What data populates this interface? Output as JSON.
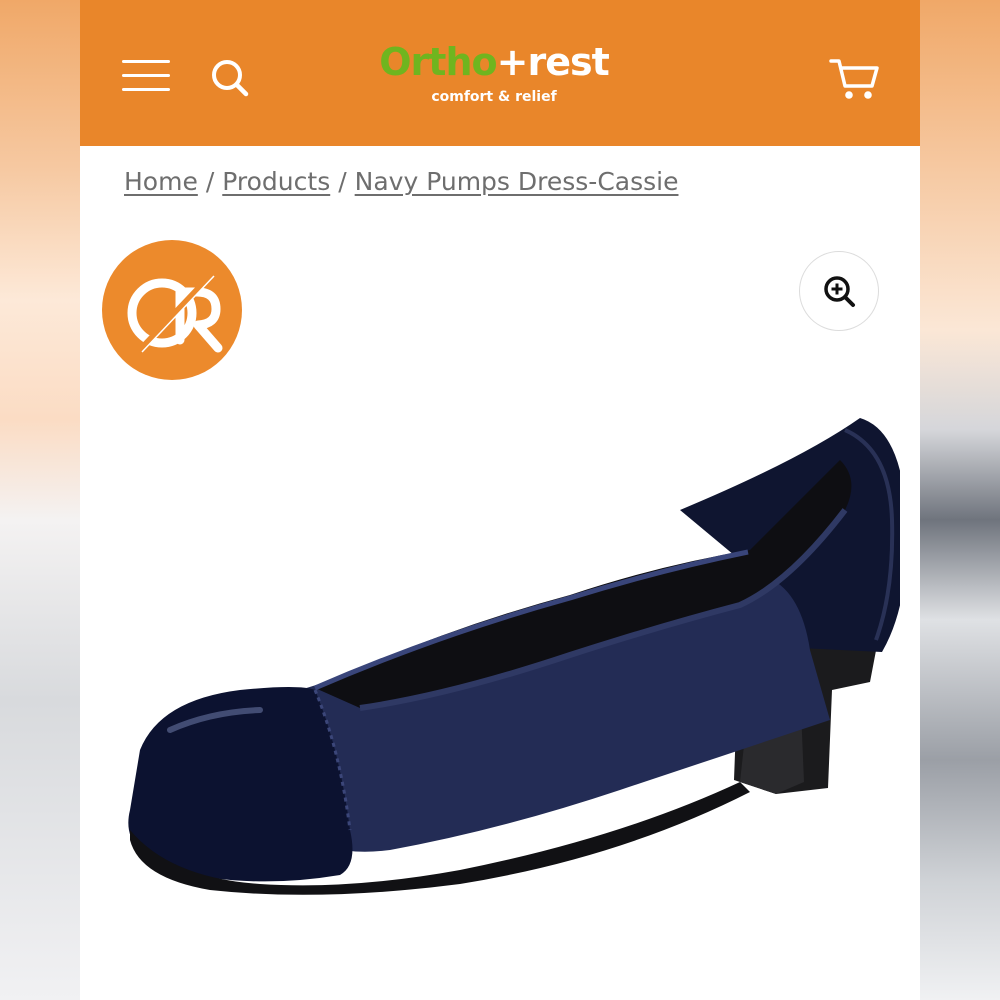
{
  "header": {
    "logo": {
      "word_green": "Ortho",
      "word_white": "+rest",
      "tagline": "comfort & relief"
    },
    "menu_icon": "hamburger-menu-icon",
    "search_icon": "search-icon",
    "cart_icon": "cart-icon",
    "accent_color": "#e9862a",
    "logo_green": "#6fb51f"
  },
  "breadcrumb": {
    "items": [
      "Home",
      "Products",
      "Navy Pumps Dress-Cassie"
    ],
    "separator": "/"
  },
  "product": {
    "badge_monogram": "OR",
    "zoom_icon": "zoom-in-icon",
    "image_subject": "navy-pump-shoe"
  }
}
